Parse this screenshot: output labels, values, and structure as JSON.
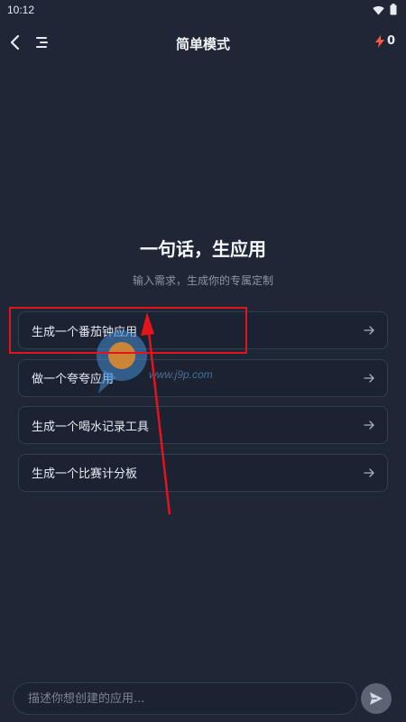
{
  "status_bar": {
    "time": "10:12",
    "icons": [
      "wifi-icon",
      "battery-icon"
    ]
  },
  "nav": {
    "back_icon": "chevron-left-icon",
    "menu_icon": "menu-icon",
    "title": "简单模式",
    "energy_icon": "lightning-icon",
    "energy_count": "0"
  },
  "hero": {
    "title": "一句话，生应用",
    "subtitle": "输入需求，生成你的专属定制"
  },
  "suggestions": [
    {
      "label": "生成一个番茄钟应用"
    },
    {
      "label": "做一个夸夸应用"
    },
    {
      "label": "生成一个喝水记录工具"
    },
    {
      "label": "生成一个比赛计分板"
    }
  ],
  "watermark": {
    "text": "www.j9p.com"
  },
  "input": {
    "placeholder": "描述你想创建的应用...",
    "value": "",
    "send_icon": "send-icon"
  },
  "colors": {
    "background": "#1f2636",
    "card": "#1b2232",
    "card_border": "#353e51",
    "annotation_red": "#e3141b",
    "energy_accent": "#ff5a3c"
  }
}
